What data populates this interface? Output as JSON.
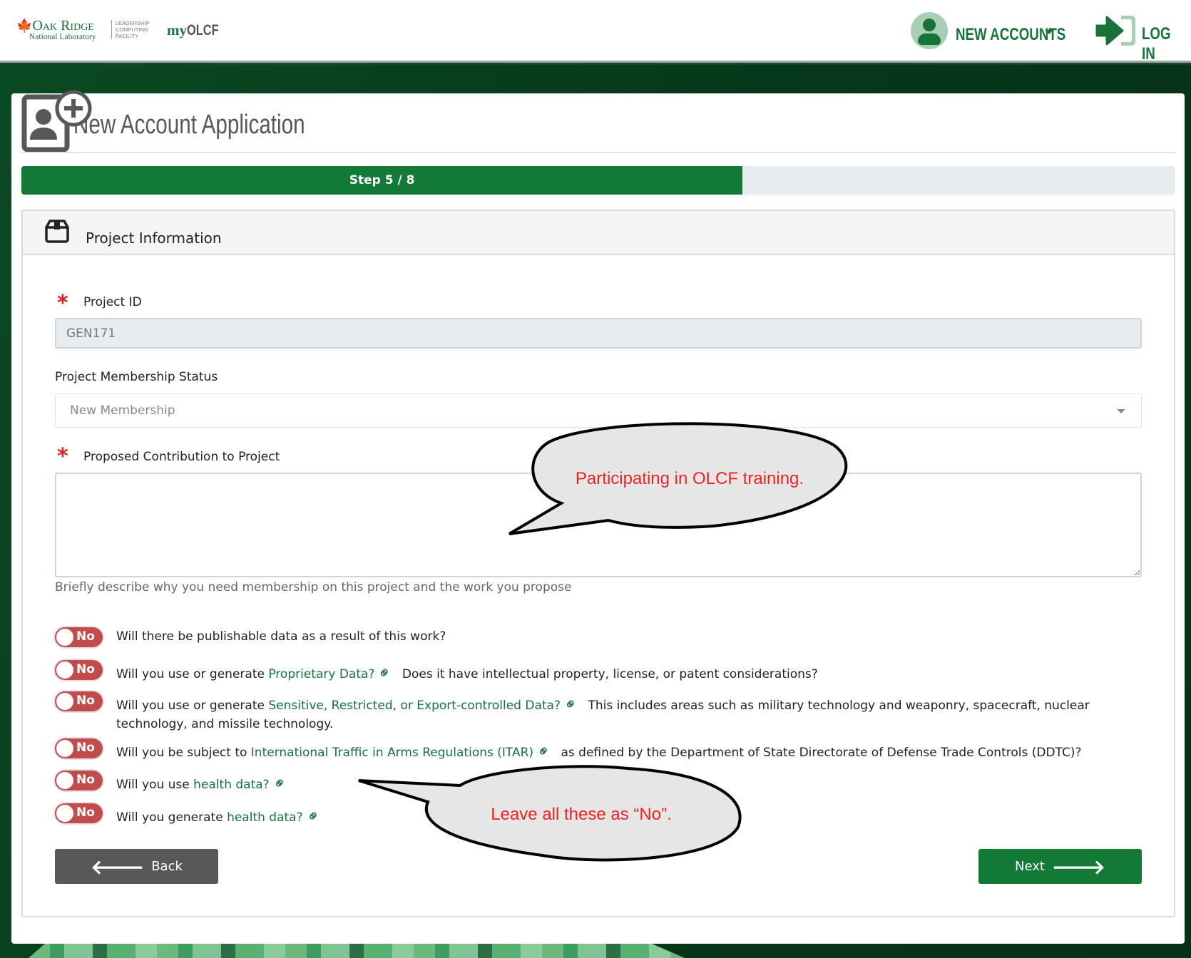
{
  "header": {
    "logo": {
      "line1": "Oak Ridge",
      "line2": "National Laboratory",
      "facility": [
        "LEADERSHIP",
        "COMPUTING",
        "FACILITY"
      ]
    },
    "brand": {
      "prefix": "my",
      "name": "OLCF"
    },
    "nav": {
      "new_accounts": "NEW ACCOUNTS",
      "login": "LOG IN"
    }
  },
  "page": {
    "title": "New Account Application"
  },
  "progress": {
    "label": "Step 5 / 8",
    "current": 5,
    "total": 8,
    "fill_color": "#137937"
  },
  "panel": {
    "title": "Project Information",
    "project_id": {
      "label": "Project ID",
      "value": "GEN171",
      "required": true
    },
    "membership": {
      "label": "Project Membership Status",
      "value": "New Membership"
    },
    "contribution": {
      "label": "Proposed Contribution to Project",
      "value": "",
      "help": "Briefly describe why you need membership on this project and the work you propose",
      "required": true
    },
    "questions": [
      {
        "toggle": "No",
        "pre": "Will there be publishable data as a result of this work?",
        "link": "",
        "post": ""
      },
      {
        "toggle": "No",
        "pre": "Will you use or generate ",
        "link": "Proprietary Data?",
        "post": "Does it have intellectual property, license, or patent considerations?"
      },
      {
        "toggle": "No",
        "pre": "Will you use or generate ",
        "link": "Sensitive, Restricted, or Export-controlled Data?",
        "post": "This includes areas such as military technology and weaponry, spacecraft, nuclear technology, and missile technology."
      },
      {
        "toggle": "No",
        "pre": "Will you be subject to ",
        "link": "International Traffic in Arms Regulations (ITAR)",
        "post": "as defined by the Department of State Directorate of Defense Trade Controls (DDTC)?"
      },
      {
        "toggle": "No",
        "pre": "Will you use ",
        "link": "health data?",
        "post": ""
      },
      {
        "toggle": "No",
        "pre": "Will you generate ",
        "link": "health data?",
        "post": ""
      }
    ],
    "back": "Back",
    "next": "Next"
  },
  "annotations": {
    "bubble1": "Participating in OLCF training.",
    "bubble2": "Leave all these as “No”."
  },
  "colors": {
    "brand_green": "#17733a",
    "toggle_off": "#c24b4c",
    "back_button": "#58585a",
    "next_button": "#137937",
    "annotation_text": "#ee2222"
  }
}
